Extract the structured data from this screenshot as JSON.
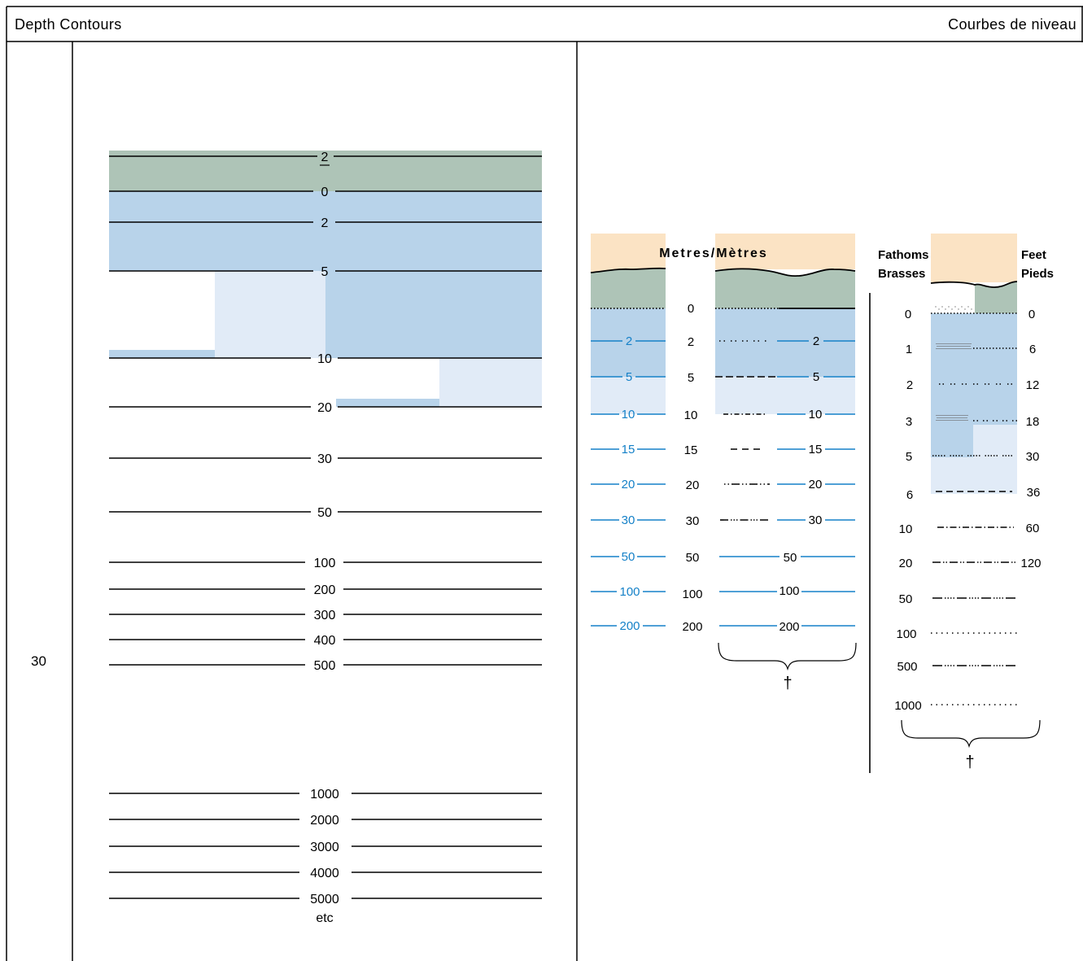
{
  "header": {
    "title": "Depth Contours",
    "title_fr": "Courbes de niveau"
  },
  "row_number": "30",
  "left_panel": {
    "drying_label": "2",
    "labels": [
      "0",
      "2",
      "5",
      "10",
      "20",
      "30",
      "50",
      "100",
      "200",
      "300",
      "400",
      "500",
      "1000",
      "2000",
      "3000",
      "4000",
      "5000"
    ],
    "etc": "etc"
  },
  "metres": {
    "title": "Metres/Mètres",
    "blue_labels": [
      "2",
      "5",
      "10",
      "15",
      "20",
      "30",
      "50",
      "100",
      "200"
    ],
    "center_labels": [
      "0",
      "2",
      "5",
      "10",
      "15",
      "20",
      "30",
      "50",
      "100",
      "200"
    ],
    "right_labels": [
      "2",
      "5",
      "10",
      "15",
      "20",
      "30",
      "50",
      "100",
      "200"
    ],
    "dagger": "†"
  },
  "fathoms": {
    "left_title_1": "Fathoms",
    "left_title_2": "Brasses",
    "right_title_1": "Feet",
    "right_title_2": "Pieds",
    "fathom_labels": [
      "0",
      "1",
      "2",
      "3",
      "5",
      "6",
      "10",
      "20",
      "50",
      "100",
      "500",
      "1000"
    ],
    "feet_labels": [
      "0",
      "6",
      "12",
      "18",
      "30",
      "36",
      "60",
      "120"
    ],
    "dagger": "†"
  },
  "colors": {
    "land": "#fbe3c4",
    "drying": "#aec4b7",
    "shallow": "#b8d3ea",
    "light": "#e1ebf7",
    "blue_line": "#1581c8"
  }
}
